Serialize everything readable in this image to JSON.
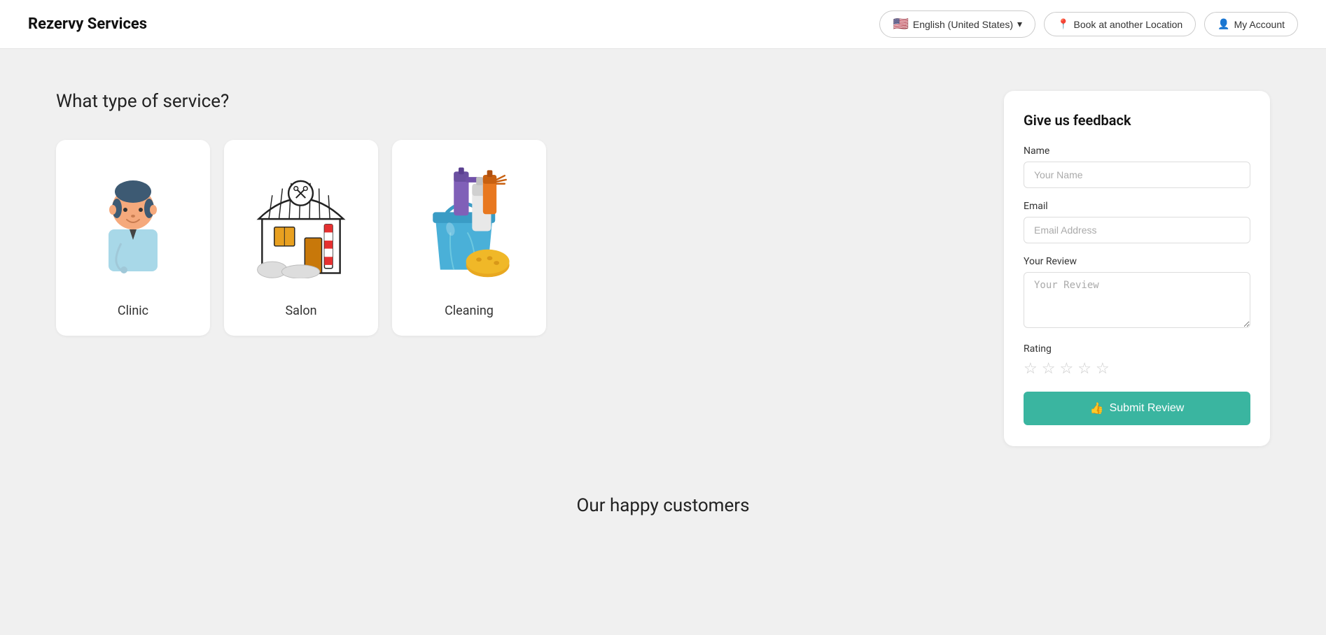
{
  "header": {
    "logo": "Rezervy Services",
    "language_btn": "English (United States)",
    "location_btn": "Book at another Location",
    "account_btn": "My Account"
  },
  "main": {
    "section_title": "What type of service?",
    "services": [
      {
        "id": "clinic",
        "label": "Clinic"
      },
      {
        "id": "salon",
        "label": "Salon"
      },
      {
        "id": "cleaning",
        "label": "Cleaning"
      }
    ]
  },
  "feedback": {
    "title": "Give us feedback",
    "name_label": "Name",
    "name_placeholder": "Your Name",
    "email_label": "Email",
    "email_placeholder": "Email Address",
    "review_label": "Your Review",
    "review_placeholder": "Your Review",
    "rating_label": "Rating",
    "submit_label": "Submit Review"
  },
  "bottom": {
    "happy_customers_title": "Our happy customers"
  }
}
